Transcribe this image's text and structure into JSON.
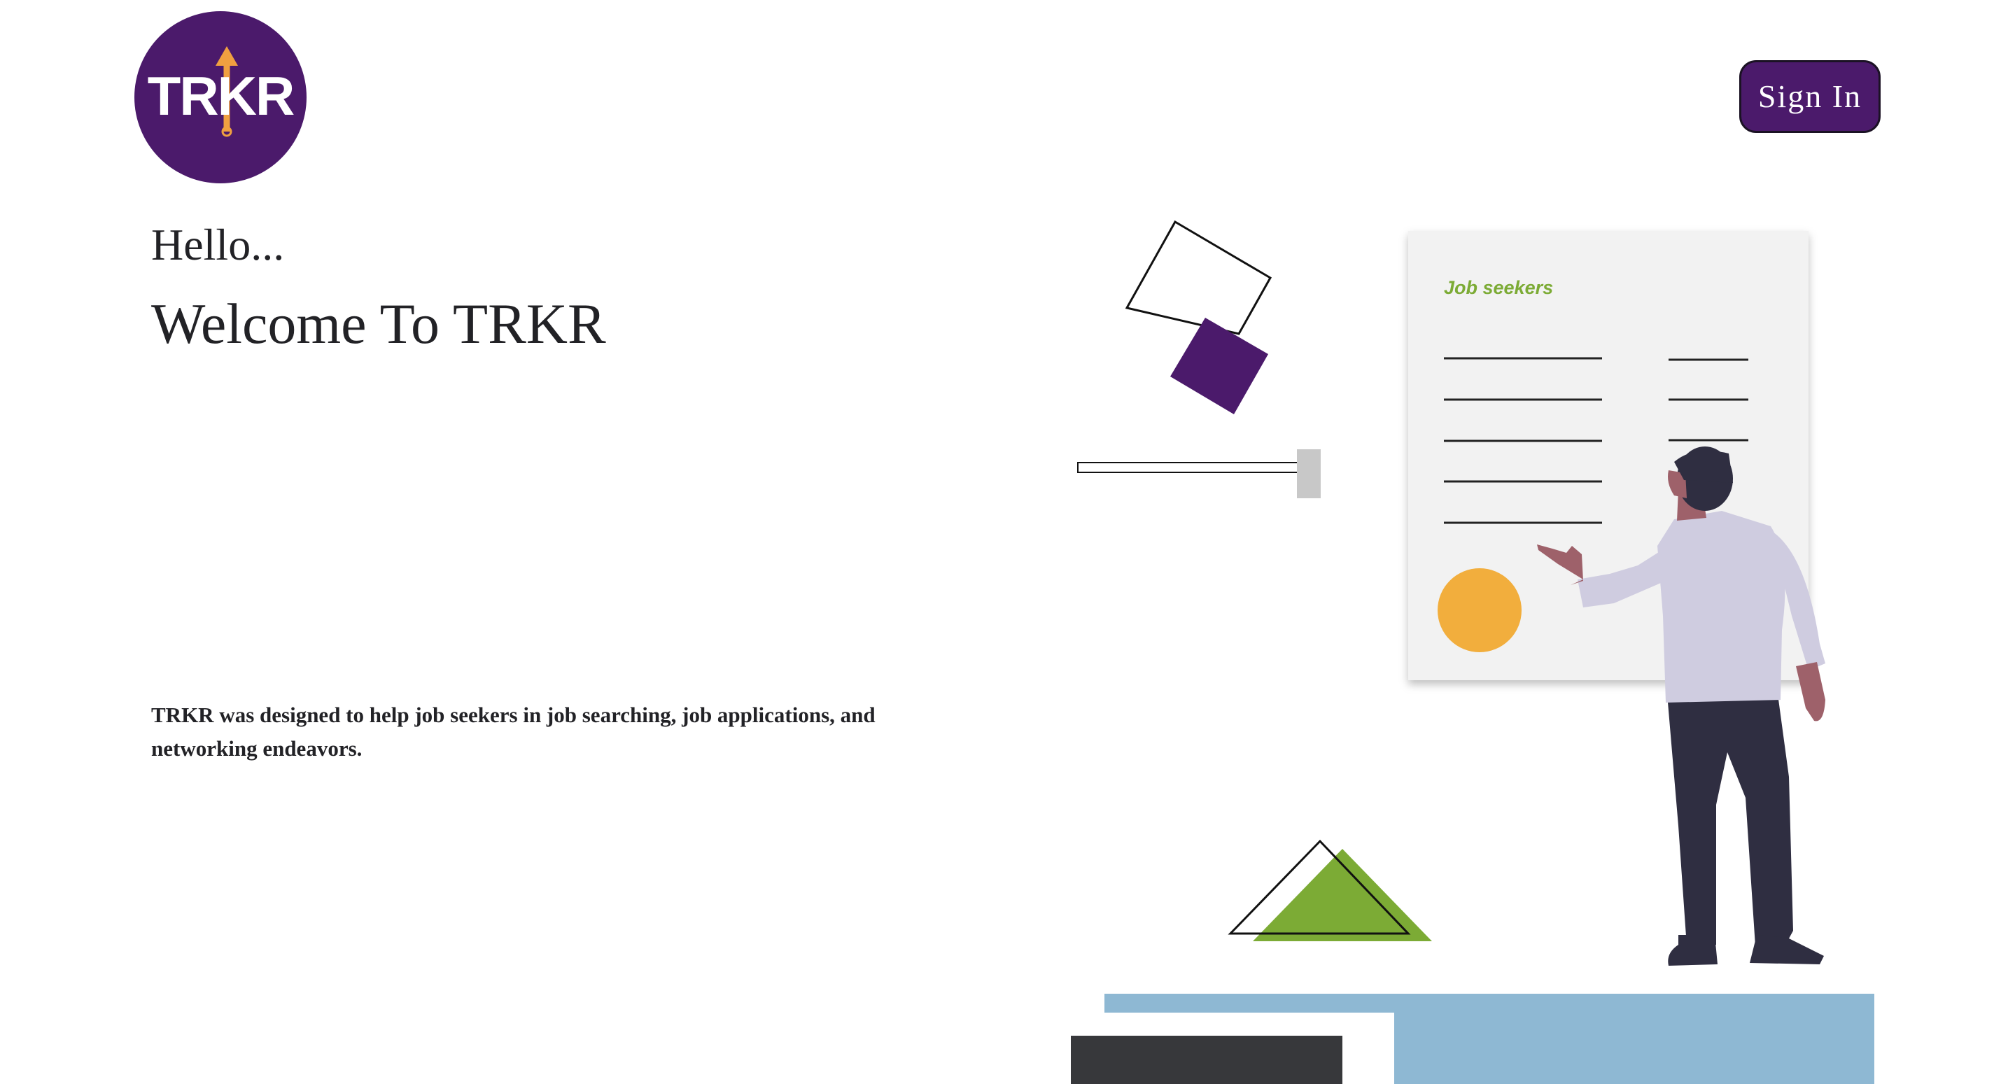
{
  "brand": {
    "logo_text": "TRKR",
    "color": "#4b1a6b",
    "accent": "#f0a040"
  },
  "header": {
    "signin_label": "Sign In"
  },
  "hero": {
    "greeting": "Hello...",
    "title": "Welcome To TRKR",
    "description": "TRKR was designed to help job seekers in job searching, job applications, and networking endeavors."
  },
  "illustration": {
    "board_label": "Job seekers",
    "colors": {
      "purple": "#4b1a6b",
      "green": "#7cab35",
      "yellow": "#f2ae3d",
      "blue": "#8eb8d3",
      "dark": "#37383b"
    }
  }
}
